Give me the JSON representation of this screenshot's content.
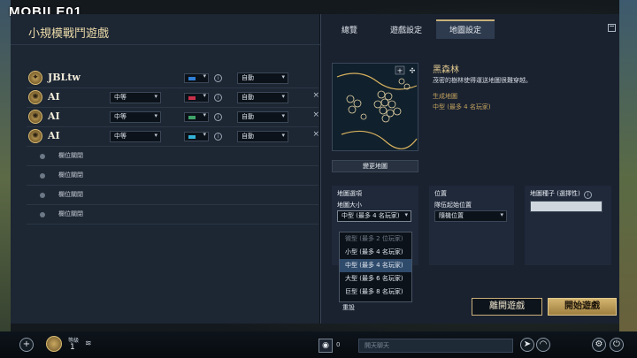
{
  "watermark": "MOBILE01",
  "lobby": {
    "title": "小規模戰鬥遊戲",
    "players": [
      {
        "name": "JBLtw",
        "difficulty": "",
        "color": "#2f7fd6",
        "team": "自動",
        "removable": false
      },
      {
        "name": "AI",
        "difficulty": "中等",
        "color": "#c9304a",
        "team": "自動",
        "removable": true
      },
      {
        "name": "AI",
        "difficulty": "中等",
        "color": "#3fa36a",
        "team": "自動",
        "removable": true
      },
      {
        "name": "AI",
        "difficulty": "中等",
        "color": "#33b2d6",
        "team": "自動",
        "removable": true
      }
    ],
    "closed_slots": [
      "欄位關閉",
      "欄位關閉",
      "欄位關閉",
      "欄位關閉"
    ],
    "close_glyph": "×",
    "info_glyph": "i"
  },
  "tabs": [
    {
      "label": "總覽",
      "active": false
    },
    {
      "label": "遊戲設定",
      "active": false
    },
    {
      "label": "地圖設定",
      "active": true
    }
  ],
  "map": {
    "name": "黑森林",
    "description": "茂密的樹林使得運送地圖很難穿越。",
    "generated_label": "生成地圖",
    "generated_value": "中型 (最多 4 名玩家)",
    "change_button": "變更地圖"
  },
  "options": {
    "map_options_title": "地圖選項",
    "map_size_label": "地圖大小",
    "map_size_value": "中型 (最多 4 名玩家)",
    "position_title": "位置",
    "start_position_label": "隊伍起始位置",
    "start_position_value": "隨機位置",
    "seed_title": "地圖種子 (選擇性)",
    "seed_value": "",
    "size_options": [
      {
        "label": "微型 (最多 2 位玩家)",
        "state": "disabled"
      },
      {
        "label": "小型 (最多 4 名玩家)",
        "state": "normal"
      },
      {
        "label": "中型 (最多 4 名玩家)",
        "state": "selected"
      },
      {
        "label": "大型 (最多 6 名玩家)",
        "state": "normal"
      },
      {
        "label": "巨型 (最多 8 名玩家)",
        "state": "normal"
      }
    ]
  },
  "actions": {
    "reset": "重設",
    "leave": "離開遊戲",
    "start": "開始遊戲"
  },
  "bottom": {
    "level_label": "等級",
    "level_value": "1",
    "chat_count": "0",
    "chat_placeholder": "開天聊天"
  }
}
